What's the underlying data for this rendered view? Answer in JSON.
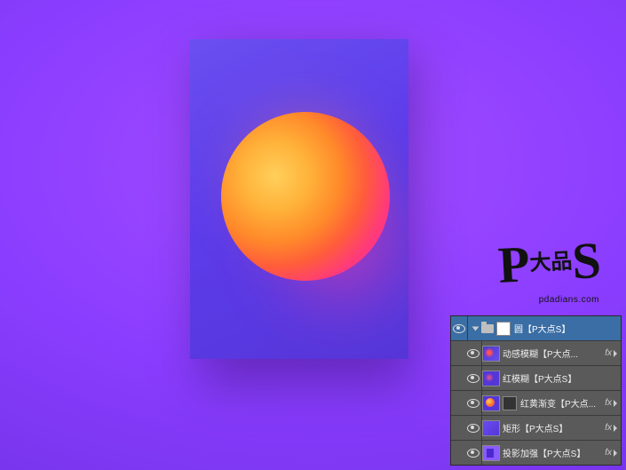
{
  "watermark": {
    "text": "P",
    "accent": "大品",
    "letter": "S",
    "url": "pdadians.com"
  },
  "panel": {
    "group": {
      "label": "圆【P大点S】"
    },
    "layers": [
      {
        "label": "动感模糊【P大点...",
        "fx": "fx"
      },
      {
        "label": "红模糊【P大点S】"
      },
      {
        "label": "红黄渐变【P大点...",
        "fx": "fx"
      },
      {
        "label": "矩形【P大点S】",
        "fx": "fx"
      },
      {
        "label": "投影加强【P大点S】",
        "fx": "fx"
      }
    ]
  }
}
